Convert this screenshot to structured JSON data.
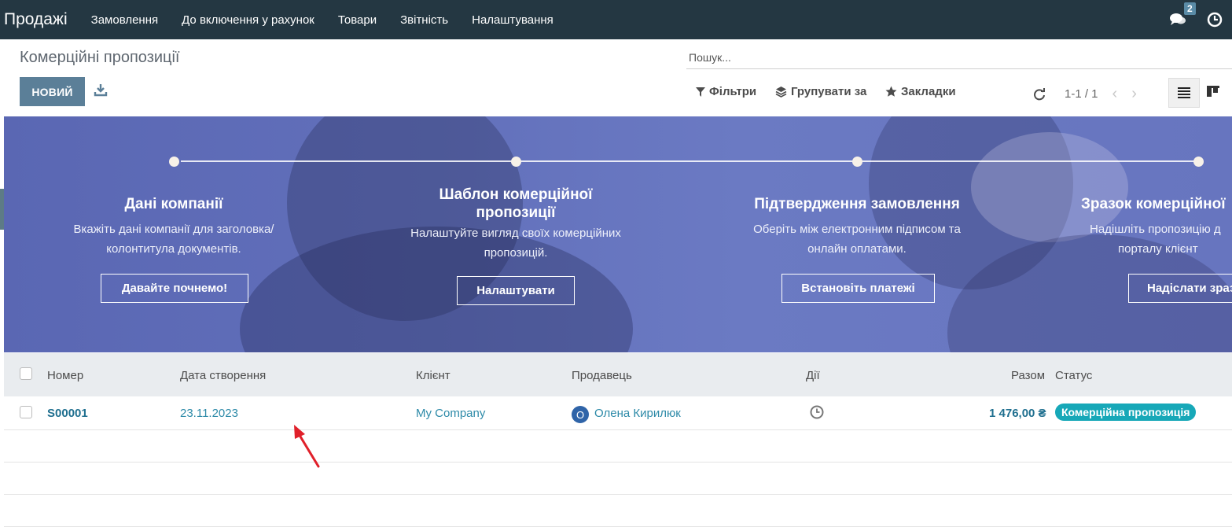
{
  "app": {
    "name": "Продажі"
  },
  "menu": [
    "Замовлення",
    "До включення у рахунок",
    "Товари",
    "Звітність",
    "Налаштування"
  ],
  "systray": {
    "messages_count": "2"
  },
  "breadcrumb": "Комерційні пропозиції",
  "buttons": {
    "new": "НОВИЙ"
  },
  "search": {
    "placeholder": "Пошук..."
  },
  "filters": {
    "filters": "Фільтри",
    "group_by": "Групувати за",
    "favorites": "Закладки"
  },
  "pager": {
    "value": "1-1 / 1"
  },
  "onboarding": [
    {
      "title": "Дані компанії",
      "desc1": "Вкажіть дані компанії для заголовка/",
      "desc2": "колонтитула документів.",
      "button": "Давайте почнемо!"
    },
    {
      "title1": "Шаблон комерційної",
      "title2": "пропозиції",
      "desc1": "Налаштуйте вигляд своїх комерційних",
      "desc2": "пропозицій.",
      "button": "Налаштувати"
    },
    {
      "title": "Підтвердження замовлення",
      "desc1": "Оберіть між електронним підписом та",
      "desc2": "онлайн оплатами.",
      "button": "Встановіть платежі"
    },
    {
      "title": "Зразок комерційної",
      "desc1": "Надішліть пропозицію д",
      "desc2": "порталу клієнт",
      "button": "Надіслати зраз"
    }
  ],
  "table": {
    "columns": {
      "number": "Номер",
      "created": "Дата створення",
      "customer": "Клієнт",
      "salesperson": "Продавець",
      "activities": "Дії",
      "total": "Разом",
      "status": "Статус"
    },
    "rows": [
      {
        "number": "S00001",
        "created": "23.11.2023",
        "customer": "My Company",
        "avatar": "О",
        "salesperson": "Олена Кирилюк",
        "total": "1 476,00 ₴",
        "status": "Комерційна пропозиція"
      }
    ]
  },
  "colors": {
    "navbar": "#243742",
    "primary": "#5b7f98",
    "link": "#2d8aa8",
    "status": "#17a8b8",
    "banner": "#6270bb",
    "arrow": "#e0202a"
  }
}
